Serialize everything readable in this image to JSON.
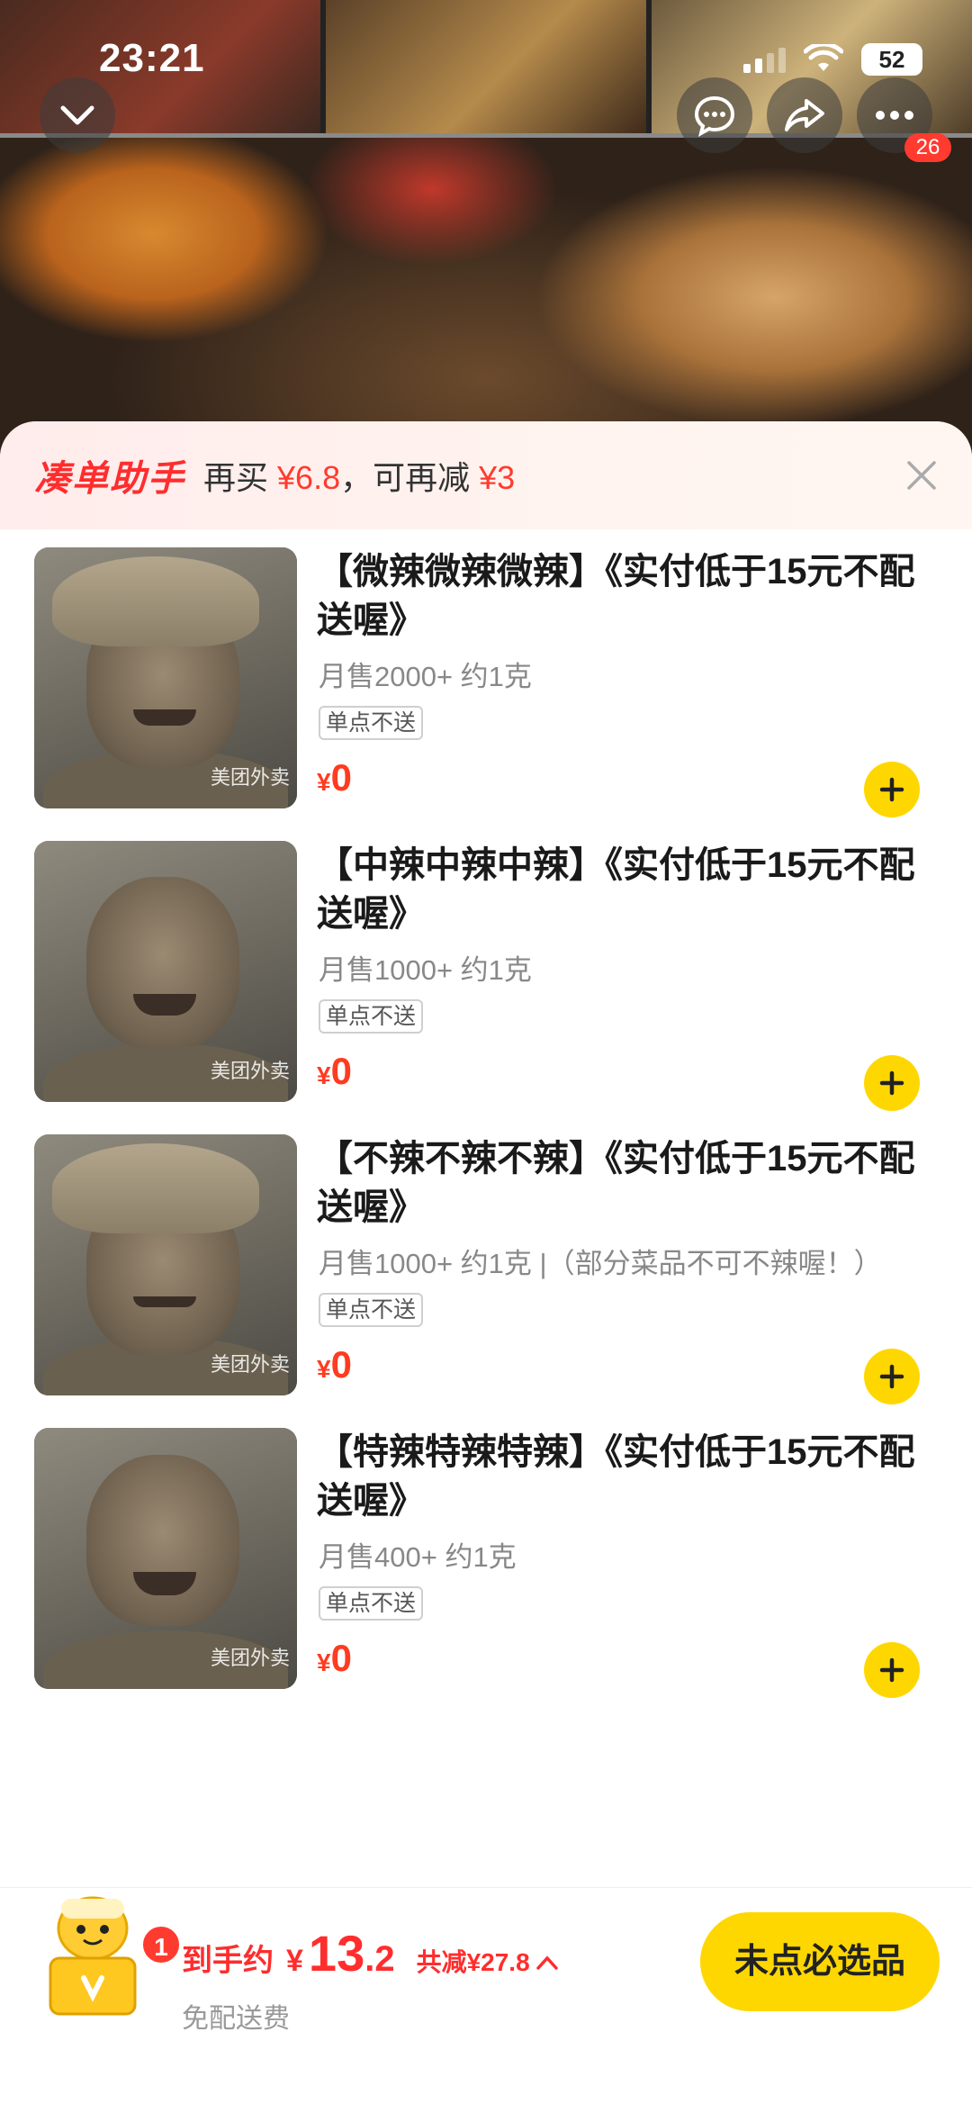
{
  "status_bar": {
    "time": "23:21",
    "battery": "52"
  },
  "header": {
    "notification_count": "26",
    "icons": [
      "chevron-down-icon",
      "chat-icon",
      "share-icon",
      "more-icon"
    ]
  },
  "assistant_bar": {
    "logo_text": "凑单助手",
    "prefix": "再买",
    "amount": "¥6.8",
    "mid": "，可再减",
    "discount": "¥3"
  },
  "items": [
    {
      "title": "【微辣微辣微辣】《实付低于15元不配送喔》",
      "meta": "月售2000+ 约1克",
      "note": "",
      "tag": "单点不送",
      "yen": "¥",
      "price": "0"
    },
    {
      "title": "【中辣中辣中辣】《实付低于15元不配送喔》",
      "meta": "月售1000+ 约1克",
      "note": "",
      "tag": "单点不送",
      "yen": "¥",
      "price": "0"
    },
    {
      "title": "【不辣不辣不辣】《实付低于15元不配送喔》",
      "meta": "月售1000+ 约1克",
      "note": "|（部分菜品不可不辣喔！）",
      "tag": "单点不送",
      "yen": "¥",
      "price": "0"
    },
    {
      "title": "【特辣特辣特辣】《实付低于15元不配送喔》",
      "meta": "月售400+ 约1克",
      "note": "",
      "tag": "单点不送",
      "yen": "¥",
      "price": "0"
    }
  ],
  "watermark": "美团外卖",
  "bottom_bar": {
    "cart_count": "1",
    "pay_label": "到手约",
    "pay_yen": "¥",
    "pay_int": "13",
    "pay_dec": ".2",
    "saving": "共减¥27.8",
    "delivery": "免配送费",
    "checkout_label": "未点必选品"
  },
  "colors": {
    "accent_yellow": "#ffd700",
    "price_red": "#ff3b20",
    "badge_red": "#ff3b30"
  }
}
